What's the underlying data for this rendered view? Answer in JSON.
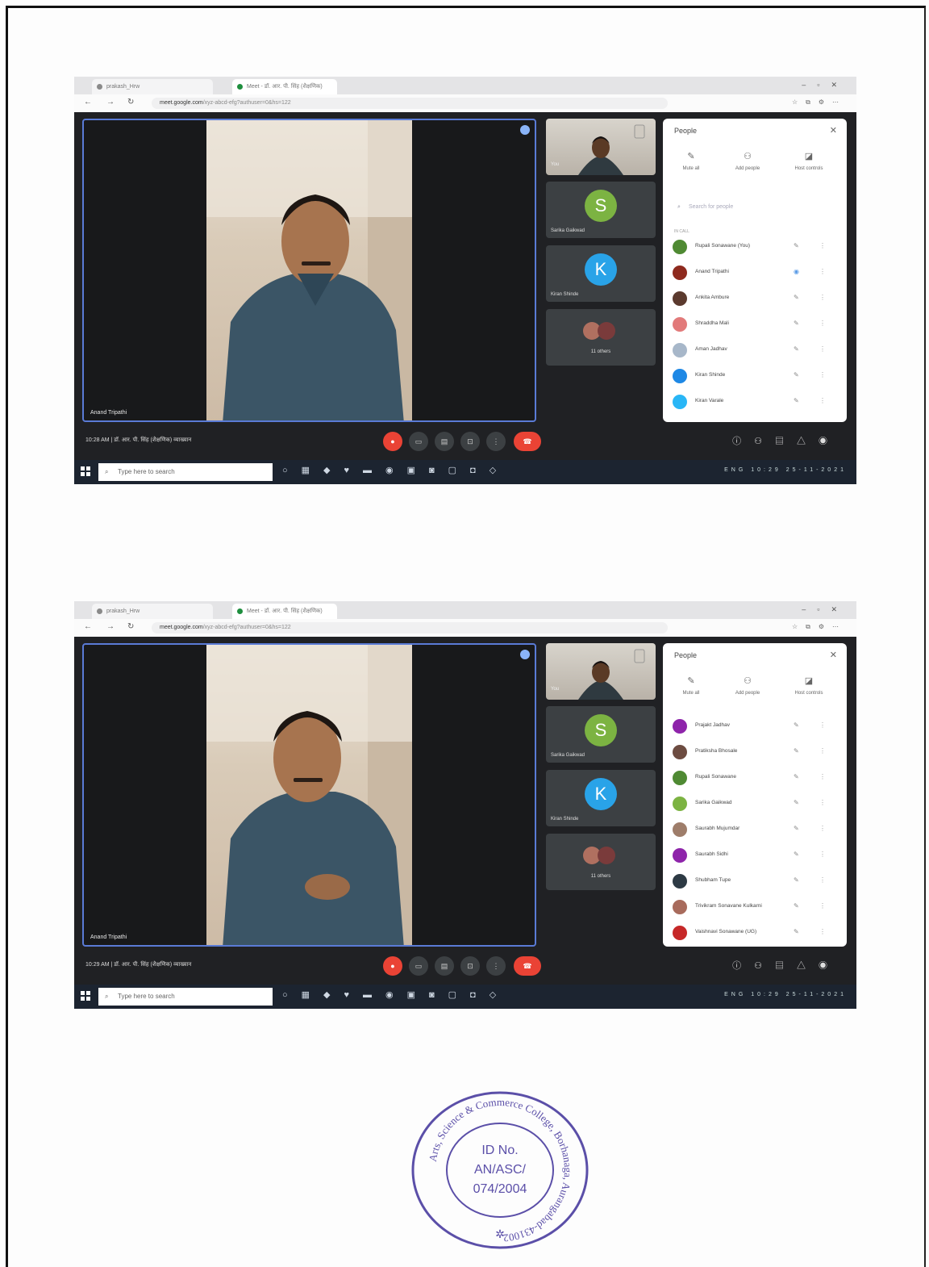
{
  "screenshots": [
    {
      "tabs": [
        "prakash_Hrw",
        "Meet - डॉ. आर. पी. सिंह (शैक्षणिक)"
      ],
      "url_host": "meet.google.com",
      "url_rest": "/xyz-abcd-efg?authuser=0&hs=122",
      "main_speaker": "Anand Tripathi",
      "self_label": "You",
      "tiles": [
        {
          "initial": "S",
          "name": "Sarika Gaikwad",
          "color": "#7cb342"
        },
        {
          "initial": "K",
          "name": "Kiran Shinde",
          "color": "#29a3e8"
        },
        {
          "count": "11 others"
        }
      ],
      "people_panel": {
        "title": "People",
        "actions": [
          "Mute all",
          "Add people",
          "Host controls"
        ],
        "search_placeholder": "Search for people",
        "section": "IN CALL",
        "participants": [
          {
            "name": "Rupali Sonawane (You)",
            "color": "#4f8a33"
          },
          {
            "name": "Anand Tripathi",
            "color": "#8e2a1e"
          },
          {
            "name": "Ankita Ambure",
            "color": "#5b3a2e"
          },
          {
            "name": "Shraddha Mali",
            "color": "#e27a7a"
          },
          {
            "name": "Aman Jadhav",
            "color": "#a7b7c9"
          },
          {
            "name": "Kiran Shinde",
            "color": "#1e88e5"
          },
          {
            "name": "Kiran Varale",
            "color": "#29b6f6"
          }
        ]
      },
      "clock": "10:28 AM",
      "meeting_title": "डॉ. आर. पी. सिंह (शैक्षणिक) व्याख्यान"
    },
    {
      "tabs": [
        "prakash_Hrw",
        "Meet - डॉ. आर. पी. सिंह (शैक्षणिक)"
      ],
      "url_host": "meet.google.com",
      "url_rest": "/xyz-abcd-efg?authuser=0&hs=122",
      "main_speaker": "Anand Tripathi",
      "self_label": "You",
      "tiles": [
        {
          "initial": "S",
          "name": "Sarika Gaikwad",
          "color": "#7cb342"
        },
        {
          "initial": "K",
          "name": "Kiran Shinde",
          "color": "#29a3e8"
        },
        {
          "count": "11 others"
        }
      ],
      "people_panel": {
        "title": "People",
        "actions": [
          "Mute all",
          "Add people",
          "Host controls"
        ],
        "participants": [
          {
            "name": "Prajakt Jadhav",
            "color": "#8e24aa"
          },
          {
            "name": "Pratiksha Bhosale",
            "color": "#6d4c41"
          },
          {
            "name": "Rupali Sonawane",
            "color": "#4f8a33"
          },
          {
            "name": "Sarika Gaikwad",
            "color": "#7cb342"
          },
          {
            "name": "Saurabh Mujumdar",
            "color": "#9e7d6a"
          },
          {
            "name": "Saurabh Sidhi",
            "color": "#8e24aa"
          },
          {
            "name": "Shubham Tupe",
            "color": "#2d3a44"
          },
          {
            "name": "Trivikram Sonavane Kulkarni",
            "color": "#a86b5c"
          },
          {
            "name": "Vaishnavi Sonawane (UG)",
            "color": "#c62828"
          }
        ]
      },
      "clock": "10:29 AM",
      "meeting_title": "डॉ. आर. पी. सिंह (शैक्षणिक) व्याख्यान"
    }
  ],
  "taskbar": {
    "search_placeholder": "Type here to search",
    "time": "10:29",
    "date": "25-11-2021",
    "lang": "ENG"
  },
  "seal": {
    "ring_text": "Arts, Science & Commerce College, Borhanaga, Aurangabad-431002",
    "id_label": "ID No.",
    "id_value_line1": "AN/ASC/",
    "id_value_line2": "074/2004"
  },
  "colors": {
    "meet_dark": "#202124",
    "accent": "#5a7bd6",
    "end_call": "#ea4335",
    "seal_ink": "#5b4fa8"
  }
}
